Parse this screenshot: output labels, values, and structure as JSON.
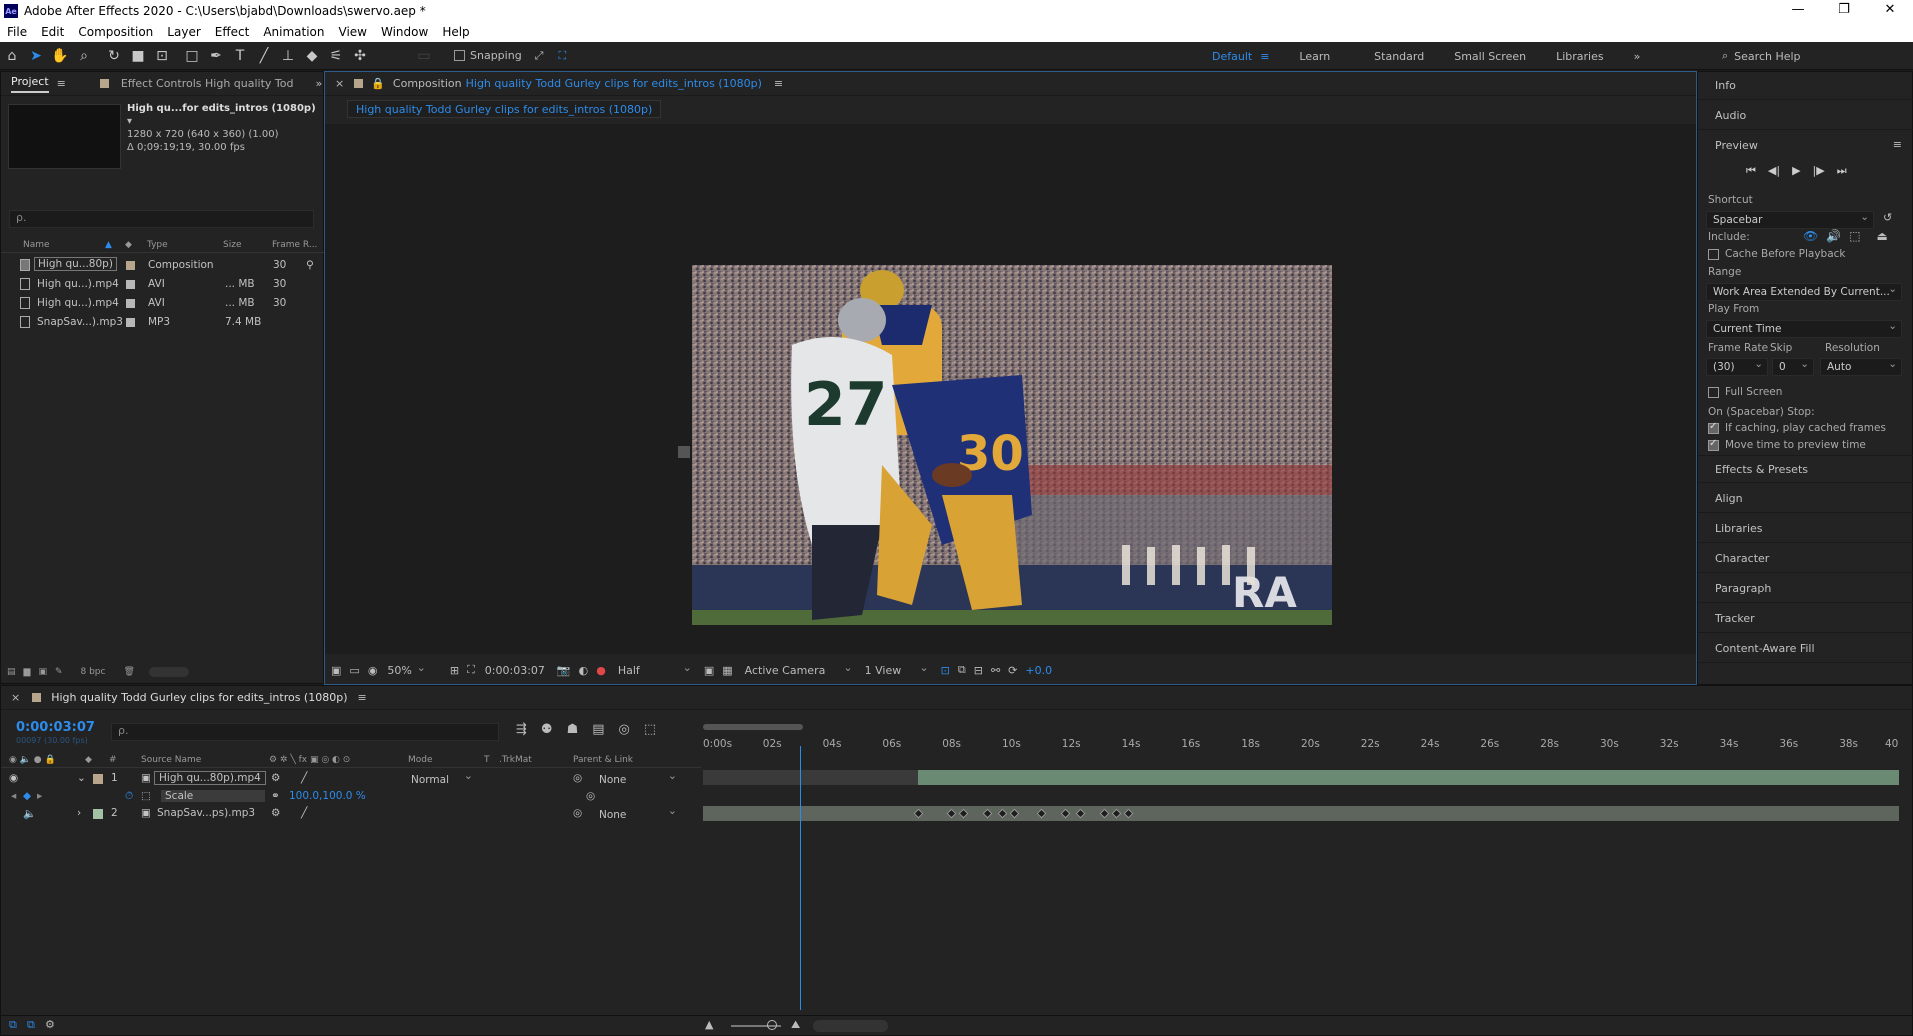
{
  "app": {
    "title": "Adobe After Effects 2020 - C:\\Users\\bjabd\\Downloads\\swervo.aep *",
    "logo": "Ae",
    "window_controls": [
      "—",
      "❐",
      "✕"
    ]
  },
  "menu": [
    "File",
    "Edit",
    "Composition",
    "Layer",
    "Effect",
    "Animation",
    "View",
    "Window",
    "Help"
  ],
  "toolbar": {
    "snapping_label": "Snapping",
    "workspaces": [
      "Default",
      "Learn",
      "Standard",
      "Small Screen",
      "Libraries"
    ],
    "active_workspace": "Default",
    "search_placeholder": "Search Help",
    "overflow": "»"
  },
  "project_panel": {
    "tab_label": "Project",
    "effect_controls_tab": "Effect Controls High quality Tod",
    "overflow": "»",
    "selected_name": "High qu...for edits_intros (1080p)",
    "selected_dims": "1280 x 720  (640 x 360) (1.00)",
    "selected_duration": "Δ 0;09:19;19, 30.00 fps",
    "search_placeholder": "ρ.",
    "columns": [
      "Name",
      "Type",
      "Size",
      "Frame R..."
    ],
    "items": [
      {
        "name": "High qu...80p)",
        "type": "Composition",
        "size": "",
        "fps": "30",
        "label_color": "#b7a68b"
      },
      {
        "name": "High qu...).mp4",
        "type": "AVI",
        "size": "... MB",
        "fps": "30",
        "label_color": "#b7b7b7"
      },
      {
        "name": "High qu...).mp4",
        "type": "AVI",
        "size": "... MB",
        "fps": "30",
        "label_color": "#b7b7b7"
      },
      {
        "name": "SnapSav...).mp3",
        "type": "MP3",
        "size": "7.4 MB",
        "fps": "",
        "label_color": "#b7b7b7"
      }
    ],
    "bpc": "8 bpc"
  },
  "comp_panel": {
    "tab_prefix": "Composition",
    "tab_name": "High quality Todd Gurley clips for edits_intros (1080p)",
    "breadcrumb": "High quality Todd Gurley clips for edits_intros (1080p)",
    "zoom": "50%",
    "timecode": "0:00:03:07",
    "resolution": "Half",
    "camera": "Active Camera",
    "views": "1 View",
    "exposure": "+0.0",
    "jersey_number": "27",
    "jersey_number_2": "30"
  },
  "right_panels": {
    "info": "Info",
    "audio": "Audio",
    "preview": "Preview",
    "shortcut_label": "Shortcut",
    "shortcut_value": "Spacebar",
    "include_label": "Include:",
    "cache_before_playback": "Cache Before Playback",
    "range_label": "Range",
    "range_value": "Work Area Extended By Current...",
    "play_from_label": "Play From",
    "play_from_value": "Current Time",
    "frame_rate_label": "Frame Rate",
    "skip_label": "Skip",
    "resolution_label": "Resolution",
    "frame_rate_value": "(30)",
    "skip_value": "0",
    "resolution_value": "Auto",
    "full_screen": "Full Screen",
    "on_stop_label": "On (Spacebar) Stop:",
    "if_caching": "If caching, play cached frames",
    "move_time": "Move time to preview time",
    "effects_presets": "Effects & Presets",
    "align": "Align",
    "libraries": "Libraries",
    "character": "Character",
    "paragraph": "Paragraph",
    "tracker": "Tracker",
    "content_aware_fill": "Content-Aware Fill"
  },
  "timeline": {
    "tab_name": "High quality Todd Gurley clips for edits_intros (1080p)",
    "timecode": "0:00:03:07",
    "timecode_sub": "00097 (30.00 fps)",
    "search_placeholder": "ρ.",
    "columns": {
      "source_name": "Source Name",
      "mode": "Mode",
      "t": "T",
      "trkmat": ".TrkMat",
      "parent": "Parent & Link",
      "num": "#"
    },
    "ruler_ticks": [
      "0:00s",
      "02s",
      "04s",
      "06s",
      "08s",
      "10s",
      "12s",
      "14s",
      "16s",
      "18s",
      "20s",
      "22s",
      "24s",
      "26s",
      "28s",
      "30s",
      "32s",
      "34s",
      "36s",
      "38s",
      "40"
    ],
    "layers": [
      {
        "index": "1",
        "name": "High qu...80p).mp4",
        "mode": "Normal",
        "parent": "None",
        "label_color": "#b7a68b"
      },
      {
        "index": "",
        "name": "Scale",
        "value": "100.0,100.0 %"
      },
      {
        "index": "2",
        "name": "SnapSav...ps).mp3",
        "mode": "",
        "parent": "None",
        "label_color": "#a3c1a3"
      }
    ],
    "playhead_seconds": 3.23,
    "ruler_end_seconds": 40
  }
}
